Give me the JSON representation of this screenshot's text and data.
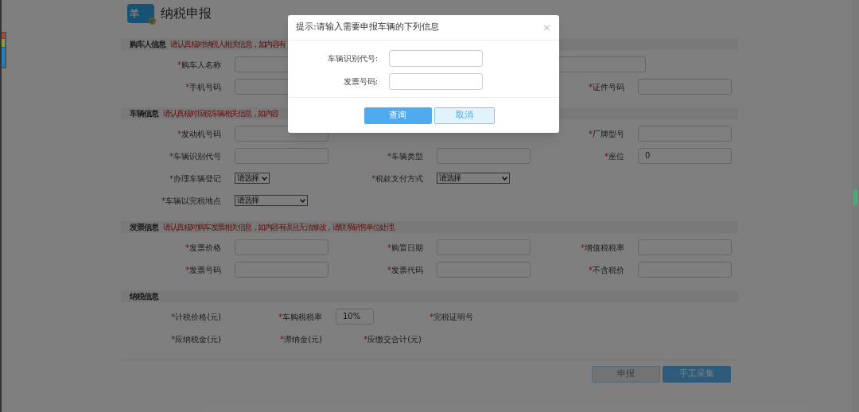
{
  "page_title": "纳税申报",
  "logo": {
    "text": "羊"
  },
  "sections": [
    {
      "title": "购车人信息",
      "note": "请认真核对纳税人相关信息，如内容有",
      "kind": "form",
      "rows": [
        [
          {
            "mark": "*",
            "label": "购车人名称",
            "kind": "wide_input"
          }
        ],
        [
          {
            "mark": "*",
            "label": "手机号码",
            "kind": "input"
          },
          null,
          {
            "mark": "*",
            "label": "证件号码",
            "kind": "input"
          }
        ]
      ]
    },
    {
      "title": "车辆信息",
      "note": "请认真核对应税车辆相关信息，如内容",
      "kind": "form",
      "rows": [
        [
          {
            "mark": "*",
            "label": "发动机号码",
            "kind": "input"
          },
          null,
          {
            "mark": "*",
            "label": "厂牌型号",
            "kind": "input"
          }
        ],
        [
          {
            "mark": "*",
            "label": "车辆识别代号",
            "kind": "input"
          },
          {
            "mark": "*",
            "label": "车辆类型",
            "kind": "input"
          },
          {
            "mark": "*",
            "label": "座位",
            "kind": "input",
            "value": "0"
          }
        ],
        [
          {
            "mark": "*",
            "label": "办理车辆登记",
            "kind": "select",
            "value": "请选择"
          },
          {
            "mark": "*",
            "label": "税款支付方式",
            "kind": "wide_select",
            "value": "请选择"
          }
        ],
        [
          {
            "mark": "*",
            "label": "车辆以完税地点",
            "kind": "wide_select",
            "value": "请选择"
          }
        ]
      ]
    },
    {
      "title": "发票信息",
      "note": "请认真核对购车发票相关信息，如内容有误且无法修改，请联系销售单位处理。",
      "kind": "form",
      "rows": [
        [
          {
            "mark": "*",
            "label": "发票价格",
            "kind": "input"
          },
          {
            "mark": "*",
            "label": "购置日期",
            "kind": "input"
          },
          {
            "mark": "*",
            "label": "增值税税率",
            "kind": "input"
          }
        ],
        [
          {
            "mark": "*",
            "label": "发票号码",
            "kind": "input"
          },
          {
            "mark": "*",
            "label": "发票代码",
            "kind": "input"
          },
          {
            "mark": "*",
            "label": "不含税价",
            "kind": "input"
          }
        ]
      ]
    },
    {
      "title": "纳税信息",
      "kind": "tax",
      "rows": [
        [
          {
            "mark": "*",
            "label": "计税价格(元)",
            "kind": "text"
          },
          {
            "mark": "*",
            "label": "车购税税率",
            "kind": "small_input",
            "value": "10%"
          },
          {
            "mark": "*",
            "label": "完税证明号",
            "kind": "text"
          }
        ],
        [
          {
            "mark": "*",
            "label": "应纳税金(元)",
            "kind": "text"
          },
          {
            "mark": "*",
            "label": "滞纳金(元)",
            "kind": "text"
          },
          {
            "mark": "*",
            "label": "应缴交合计(元)",
            "kind": "text"
          }
        ]
      ]
    }
  ],
  "actions": [
    {
      "label": "申报",
      "disabled": true
    },
    {
      "label": "手工采集",
      "disabled": false
    }
  ],
  "dialog": {
    "title": "提示:请输入需要申报车辆的下列信息",
    "close": "×",
    "fields": [
      {
        "label": "车辆识别代号:"
      },
      {
        "label": "发票号码:"
      }
    ],
    "buttons": [
      {
        "label": "查询",
        "kind": "primary"
      },
      {
        "label": "取消",
        "kind": "secondary"
      }
    ]
  }
}
